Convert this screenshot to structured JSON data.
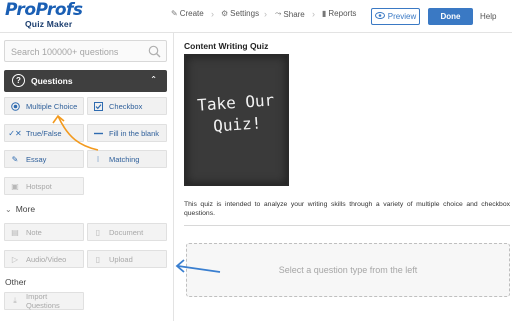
{
  "app": {
    "logo_pro": "Pro",
    "logo_profs": "Profs",
    "logo_sub": "Quiz Maker"
  },
  "nav": {
    "create": "Create",
    "settings": "Settings",
    "share": "Share",
    "reports": "Reports",
    "preview": "Preview",
    "done": "Done",
    "help": "Help"
  },
  "sidebar": {
    "search_placeholder": "Search 100000+ questions",
    "questions_header": "Questions",
    "question_types": [
      {
        "label": "Multiple Choice",
        "icon": "radio-icon"
      },
      {
        "label": "Checkbox",
        "icon": "checkbox-icon"
      },
      {
        "label": "True/False",
        "icon": "true-false-icon"
      },
      {
        "label": "Fill in the blank",
        "icon": "blank-line-icon"
      },
      {
        "label": "Essay",
        "icon": "pencil-icon"
      },
      {
        "label": "Matching",
        "icon": "matching-icon"
      },
      {
        "label": "Hotspot",
        "icon": "hotspot-icon"
      }
    ],
    "more_header": "More",
    "more_items": [
      {
        "label": "Note",
        "icon": "note-icon"
      },
      {
        "label": "Document",
        "icon": "document-icon"
      },
      {
        "label": "Audio/Video",
        "icon": "audio-video-icon"
      },
      {
        "label": "Upload",
        "icon": "upload-icon"
      }
    ],
    "other_header": "Other",
    "other_items": [
      {
        "label": "Import Questions",
        "icon": "import-icon"
      }
    ]
  },
  "main": {
    "quiz_title": "Content Writing Quiz",
    "cover_line1": "Take Our",
    "cover_line2": "Quiz!",
    "description": "This quiz is intended to analyze your writing skills through a variety of multiple choice and checkbox questions.",
    "dropzone_text": "Select a question type from the left"
  },
  "colors": {
    "brand_blue": "#3a79c4",
    "header_dark": "#3f3f3f",
    "annotation_orange": "#f39a1e",
    "annotation_blue": "#3a7fd0"
  }
}
